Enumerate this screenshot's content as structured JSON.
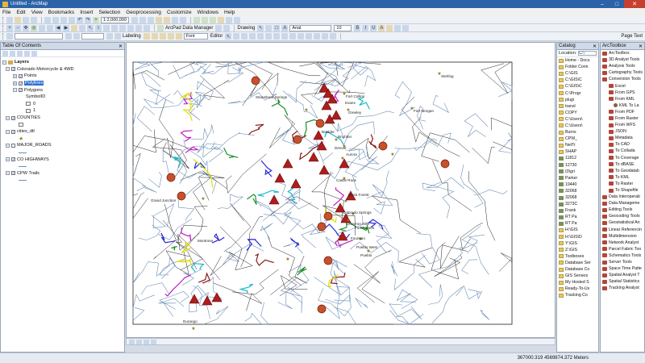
{
  "window": {
    "title": "Untitled - ArcMap"
  },
  "menu": [
    "File",
    "Edit",
    "View",
    "Bookmarks",
    "Insert",
    "Selection",
    "Geoprocessing",
    "Customize",
    "Windows",
    "Help"
  ],
  "toolbar": {
    "scale": "1:2,000,000",
    "labeling": "Labeling",
    "arcpad": "ArcPad Data Manager",
    "font_box": "Font",
    "editor": "Editor",
    "drawing": "Drawing",
    "font_name": "Arial",
    "font_size": "10",
    "page_text": "Page Text"
  },
  "toc": {
    "title": "Table Of Contents",
    "root": "Layers",
    "items": [
      {
        "label": "Colorado Motorcycle & 4WD",
        "level": 1,
        "checked": true,
        "expander": "−"
      },
      {
        "label": "Points",
        "level": 2,
        "checked": true,
        "expander": "+"
      },
      {
        "label": "Polylines",
        "level": 2,
        "checked": true,
        "expander": "+",
        "selected": true
      },
      {
        "label": "Polygons",
        "level": 2,
        "checked": true,
        "expander": "−"
      },
      {
        "label": "SymbolID",
        "level": 3
      },
      {
        "label": "0",
        "level": 3,
        "swatch": "#f4f4f4"
      },
      {
        "label": "1",
        "level": 3,
        "swatch": "#f4f4f4"
      },
      {
        "label": "COUNTIES",
        "level": 1,
        "checked": true,
        "expander": "−"
      },
      {
        "label": "",
        "level": 2,
        "swatch": "#ffffff"
      },
      {
        "label": "cities_dtl",
        "level": 1,
        "checked": true,
        "expander": "−"
      },
      {
        "label": "★",
        "level": 2,
        "star": true
      },
      {
        "label": "MAJOR_ROADS",
        "level": 1,
        "checked": false,
        "expander": "−"
      },
      {
        "label": "—",
        "level": 2,
        "line": true
      },
      {
        "label": "CO HIGHWAYS",
        "level": 1,
        "checked": true,
        "expander": "−"
      },
      {
        "label": "—",
        "level": 2,
        "line": true
      },
      {
        "label": "CPW Trails",
        "level": 1,
        "checked": true,
        "expander": "−"
      },
      {
        "label": "—",
        "level": 2,
        "line": true
      }
    ]
  },
  "map": {
    "places": [
      "Fort Collins",
      "Greeley",
      "Fort Morgan",
      "Sterling",
      "Steamboat Springs",
      "Boulder",
      "Denver",
      "Aurora",
      "Castle Rock",
      "Grand Junction",
      "Montrose",
      "Colorado Springs",
      "Black Forest",
      "Fort Carson",
      "Fountain",
      "Pueblo West",
      "Pueblo",
      "Durango",
      "Evans",
      "Brighton",
      "Cimarron Hills"
    ]
  },
  "catalog": {
    "title": "Catalog",
    "location_label": "Location:",
    "location_value": "C:\\",
    "items": [
      {
        "label": "Home - Docu",
        "type": "folder"
      },
      {
        "label": "Folder Conn",
        "type": "folder"
      },
      {
        "label": "C:\\GIS",
        "type": "folder"
      },
      {
        "label": "C:\\GIS\\C",
        "type": "folder"
      },
      {
        "label": "C:\\GIS\\C",
        "type": "folder"
      },
      {
        "label": "C:\\Progr",
        "type": "folder"
      },
      {
        "label": "plugi",
        "type": "folder"
      },
      {
        "label": "transl",
        "type": "folder"
      },
      {
        "label": "COPY",
        "type": "file"
      },
      {
        "label": "C:\\Users\\",
        "type": "folder"
      },
      {
        "label": "C:\\Users\\",
        "type": "folder"
      },
      {
        "label": "Burns",
        "type": "folder"
      },
      {
        "label": "CPW_",
        "type": "folder"
      },
      {
        "label": "NetTr",
        "type": "folder"
      },
      {
        "label": "SHAP",
        "type": "folder"
      },
      {
        "label": "11812",
        "type": "db"
      },
      {
        "label": "12730",
        "type": "db"
      },
      {
        "label": "{0\\gri",
        "type": "db"
      },
      {
        "label": "Parker",
        "type": "db"
      },
      {
        "label": "19440",
        "type": "db"
      },
      {
        "label": "32068",
        "type": "db"
      },
      {
        "label": "32068",
        "type": "db"
      },
      {
        "label": "3273C",
        "type": "db"
      },
      {
        "label": "Frank",
        "type": "db"
      },
      {
        "label": "RT Pa",
        "type": "db"
      },
      {
        "label": "RT Pa",
        "type": "db"
      },
      {
        "label": "H:\\GIS",
        "type": "folder"
      },
      {
        "label": "H:\\GIS\\D",
        "type": "folder"
      },
      {
        "label": "Y:\\GIS",
        "type": "folder"
      },
      {
        "label": "Z:\\GIS",
        "type": "folder"
      },
      {
        "label": "Toolboxes",
        "type": "folder"
      },
      {
        "label": "Database Ser",
        "type": "folder"
      },
      {
        "label": "Database Co",
        "type": "folder"
      },
      {
        "label": "GIS Servers",
        "type": "folder"
      },
      {
        "label": "My Hosted S",
        "type": "folder"
      },
      {
        "label": "Ready-To-Us",
        "type": "folder"
      },
      {
        "label": "Tracking Co",
        "type": "folder"
      }
    ]
  },
  "toolbox": {
    "title": "ArcToolbox",
    "items": [
      {
        "label": "ArcToolbox",
        "type": "box"
      },
      {
        "label": "3D Analyst Tools",
        "type": "box"
      },
      {
        "label": "Analysis Tools",
        "type": "box"
      },
      {
        "label": "Cartography Tools",
        "type": "box"
      },
      {
        "label": "Conversion Tools",
        "type": "box"
      },
      {
        "label": "Excel",
        "type": "box"
      },
      {
        "label": "From GPS",
        "type": "box"
      },
      {
        "label": "From KML",
        "type": "box"
      },
      {
        "label": "KML To La",
        "type": "tool"
      },
      {
        "label": "From PDF",
        "type": "box"
      },
      {
        "label": "From Raster",
        "type": "box"
      },
      {
        "label": "From WFS",
        "type": "box"
      },
      {
        "label": "JSON",
        "type": "box"
      },
      {
        "label": "Metadata",
        "type": "box"
      },
      {
        "label": "To CAD",
        "type": "box"
      },
      {
        "label": "To Collada",
        "type": "box"
      },
      {
        "label": "To Coverage",
        "type": "box"
      },
      {
        "label": "To dBASE",
        "type": "box"
      },
      {
        "label": "To Geodatab",
        "type": "box"
      },
      {
        "label": "To KML",
        "type": "box"
      },
      {
        "label": "To Raster",
        "type": "box"
      },
      {
        "label": "To Shapefile",
        "type": "box"
      },
      {
        "label": "Data Interoperab",
        "type": "box"
      },
      {
        "label": "Data Manageme",
        "type": "box"
      },
      {
        "label": "Editing Tools",
        "type": "box"
      },
      {
        "label": "Geocoding Tools",
        "type": "box"
      },
      {
        "label": "Geostatistical An",
        "type": "box"
      },
      {
        "label": "Linear Referencin",
        "type": "box"
      },
      {
        "label": "Multidimension",
        "type": "box"
      },
      {
        "label": "Network Analyst",
        "type": "box"
      },
      {
        "label": "Parcel Fabric Too",
        "type": "box"
      },
      {
        "label": "Schematics Tools",
        "type": "box"
      },
      {
        "label": "Server Tools",
        "type": "box"
      },
      {
        "label": "Space Time Patte",
        "type": "box"
      },
      {
        "label": "Spatial Analyst T",
        "type": "box"
      },
      {
        "label": "Spatial Statistics",
        "type": "box"
      },
      {
        "label": "Tracking Analyst",
        "type": "box"
      }
    ]
  },
  "status": {
    "coords": "367000.319  4569874.372 Meters"
  },
  "colors": {
    "title_bar": "#2b62a8",
    "panel_header": "#cfd9e8",
    "selection": "#2f6fd0",
    "road": "#6d8fb8",
    "county": "#222222",
    "poi": "#b01c1c"
  }
}
